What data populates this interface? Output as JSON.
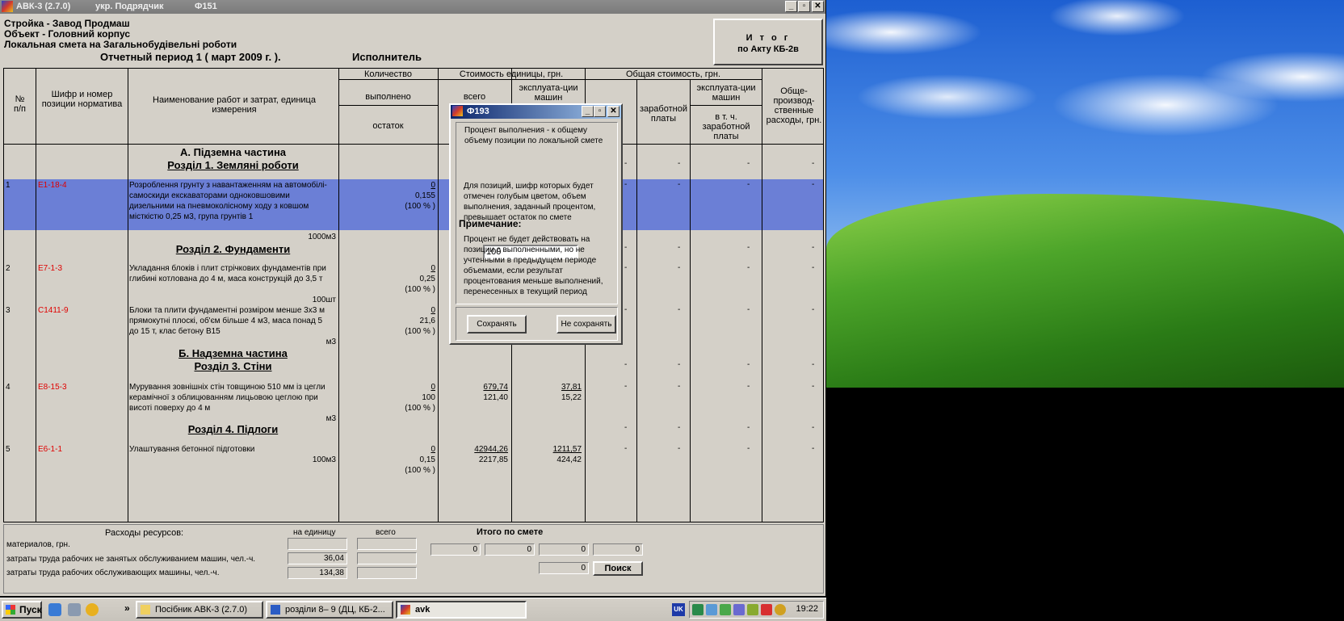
{
  "window": {
    "title": "АВК-3 (2.7.0)",
    "role": "укр.  Подрядчик",
    "form": "Ф151",
    "minimize": "_",
    "maximize": "▫",
    "close": "✕"
  },
  "header": {
    "line1": "Стройка - Завод Продмаш",
    "line2": "Объект - Головний корпус",
    "line3": "Локальная смета на Загальнобудівельні роботи",
    "period": "Отчетный период 1    ( март  2009 г. ).",
    "executor": "Исполнитель",
    "itog_line1": "И т о г",
    "itog_line2": "по Акту КБ-2в"
  },
  "columns": {
    "npp": "№\nп/п",
    "code": "Шифр и номер позиции норматива",
    "name": "Наименование работ и затрат, единица измерения",
    "qty": "Количество",
    "qty_done": "выполнено",
    "qty_rest": "остаток",
    "unit_cost": "Стоимость единицы, грн.",
    "unit_total": "всего",
    "unit_mach": "эксплуата-ции машин",
    "total_cost": "Общая стоимость, грн.",
    "salary": "заработной платы",
    "mach": "эксплуата-ции машин",
    "mach_sal": "в т. ч. заработной платы",
    "overhead": "Обще-производ-ственные расходы, грн."
  },
  "sections": {
    "a": "А.   Підземна частина",
    "s1": "Розділ 1. Земляні роботи",
    "s2": "Розділ 2. Фундаменти",
    "b": "Б.   Надземна частина",
    "s3": "Розділ 3. Стіни",
    "s4": "Розділ 4. Підлоги"
  },
  "rows": [
    {
      "n": "1",
      "code": "Е1-18-4",
      "name": "Розроблення грунту з навантаженням на автомобілі-самоскиди екскаваторами одноковшовими дизельними на пневмоколісному ходу з ковшом місткістю 0,25 м3, група грунтів 1",
      "unit": "1000м3",
      "done": "0",
      "rest": "0,155",
      "pct": "(100 % )"
    },
    {
      "n": "2",
      "code": "Е7-1-3",
      "name": "Укладання блоків і плит стрічкових фундаментів при глибині котлована до 4 м, маса конструкцій до 3,5 т",
      "unit": "100шт",
      "done": "0",
      "rest": "0,25",
      "pct": "(100 % )"
    },
    {
      "n": "3",
      "code": "С1411-9",
      "name": "Блоки та плити фундаментні розміром менше 3х3 м прямокутні плоскі, об'єм більше 4 м3, маса понад 5 до 15 т, клас бетону В15",
      "unit": "м3",
      "done": "0",
      "rest": "21,6",
      "pct": "(100 % )"
    },
    {
      "n": "4",
      "code": "Е8-15-3",
      "name": "Мурування зовнішніх стін товщиною 510 мм із цегли керамічної з облицюванням лицьовою цеглою при висоті поверху до 4 м",
      "unit": "м3",
      "done": "0",
      "rest": "100",
      "pct": "(100 % )",
      "total": "679,74",
      "total2": "121,40",
      "mach": "37,81",
      "mach2": "15,22"
    },
    {
      "n": "5",
      "code": "Е6-1-1",
      "name": "Улаштування бетонної підготовки",
      "unit": "100м3",
      "done": "0",
      "rest": "0,15",
      "pct": "(100 % )",
      "total": "42944,26",
      "total2": "2217,85",
      "mach": "1211,57",
      "mach2": "424,42"
    }
  ],
  "dash": "-",
  "bottom": {
    "res_title": "Расходы ресурсов:",
    "per_unit": "на единицу",
    "all": "всего",
    "itogo": "Итого    по    смете",
    "mat": "материалов, грн.",
    "labor1": "затраты труда рабочих не занятых обслуживанием машин, чел.-ч.",
    "labor2": "затраты труда рабочих обслуживающих машины, чел.-ч.",
    "labor1_val": "36,04",
    "labor2_val": "134,38",
    "t1": "0",
    "t2": "0",
    "t3": "0",
    "t4": "0",
    "t5": "0",
    "search": "Поиск"
  },
  "dialog": {
    "title": "Ф193",
    "text1": "Процент выполнения - к общему объему позиции по локальной смете",
    "input_value": "100",
    "text2": "Для позиций, шифр которых будет отмечен голубым цветом, объем выполнения, заданный процентом, превышает остаток по смете",
    "note_title": "Примечание:",
    "text3": "Процент не будет действовать на позиции с выполненными, но не учтенными в предыдущем периоде объемами, если результат процентования меньше выполнений, перенесенных в текущий период",
    "save": "Сохранять",
    "nosave": "Не сохранять"
  },
  "taskbar": {
    "start": "Пуск",
    "more": "»",
    "task1": "Посібник АВК-3 (2.7.0)",
    "task2": "розділи 8– 9 (ДЦ, КБ-2...",
    "task3": "avk",
    "lang": "UK",
    "clock": "19:22"
  },
  "colors": {
    "highlight_row": "#6b7fd6",
    "code_red": "#e00000",
    "dialog_title": "#0a246a"
  }
}
